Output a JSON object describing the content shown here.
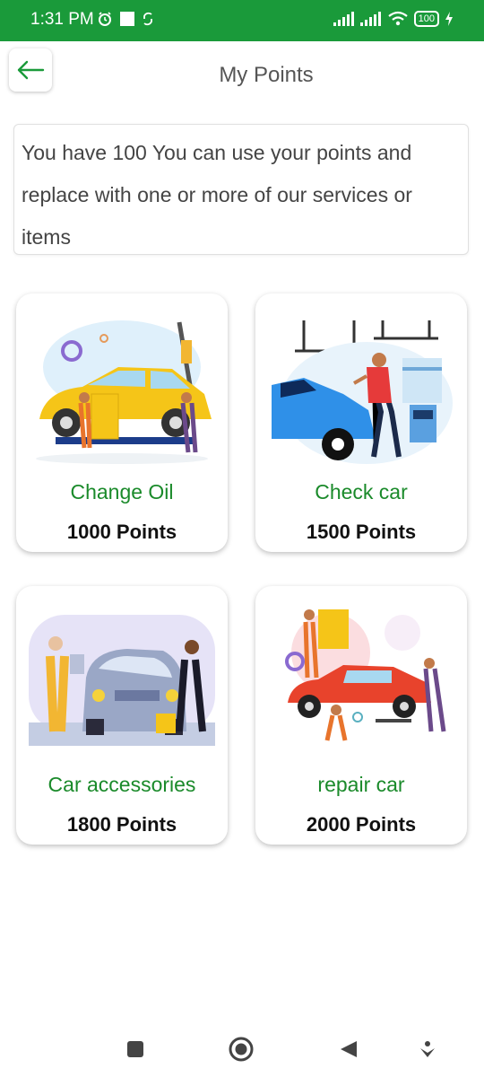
{
  "status_bar": {
    "time": "1:31 PM",
    "battery": "100",
    "color": "#1a9a3a"
  },
  "header": {
    "title": "My Points",
    "back_icon": "arrow-left-icon"
  },
  "info": {
    "text": "You have 100 You can use your points and replace with one or more of our services or items"
  },
  "cards": [
    {
      "name": "Change Oil",
      "points": "1000 Points",
      "image": "car-oil-change-illustration"
    },
    {
      "name": "Check car",
      "points": "1500 Points",
      "image": "car-check-illustration"
    },
    {
      "name": "Car accessories",
      "points": "1800 Points",
      "image": "car-accessories-illustration"
    },
    {
      "name": "repair car",
      "points": "2000 Points",
      "image": "car-repair-illustration"
    }
  ],
  "nav": {
    "items": [
      "recents-icon",
      "home-icon",
      "back-icon",
      "assistant-icon"
    ]
  },
  "colors": {
    "accent_green": "#1a8a2a",
    "status_green": "#1a9a3a"
  }
}
